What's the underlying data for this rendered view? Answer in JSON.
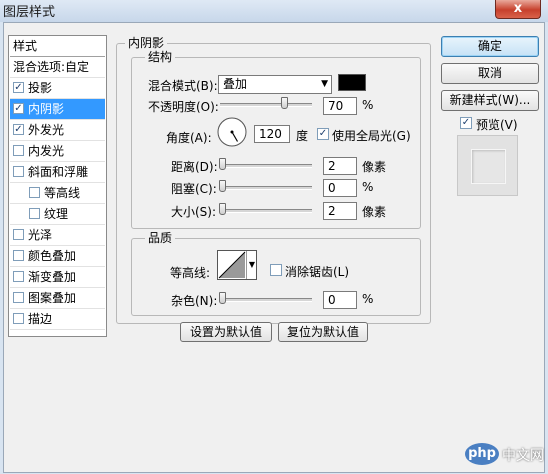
{
  "window": {
    "title": "图层样式",
    "close_glyph": "x"
  },
  "left_panel": {
    "header": "样式",
    "items": [
      {
        "label": "混合选项:自定",
        "checkbox": false,
        "checked": false,
        "selected": false,
        "indent": 0
      },
      {
        "label": "投影",
        "checkbox": true,
        "checked": true,
        "selected": false,
        "indent": 0
      },
      {
        "label": "内阴影",
        "checkbox": true,
        "checked": true,
        "selected": true,
        "indent": 0
      },
      {
        "label": "外发光",
        "checkbox": true,
        "checked": true,
        "selected": false,
        "indent": 0
      },
      {
        "label": "内发光",
        "checkbox": true,
        "checked": false,
        "selected": false,
        "indent": 0
      },
      {
        "label": "斜面和浮雕",
        "checkbox": true,
        "checked": false,
        "selected": false,
        "indent": 0
      },
      {
        "label": "等高线",
        "checkbox": true,
        "checked": false,
        "selected": false,
        "indent": 1
      },
      {
        "label": "纹理",
        "checkbox": true,
        "checked": false,
        "selected": false,
        "indent": 1
      },
      {
        "label": "光泽",
        "checkbox": true,
        "checked": false,
        "selected": false,
        "indent": 0
      },
      {
        "label": "颜色叠加",
        "checkbox": true,
        "checked": false,
        "selected": false,
        "indent": 0
      },
      {
        "label": "渐变叠加",
        "checkbox": true,
        "checked": false,
        "selected": false,
        "indent": 0
      },
      {
        "label": "图案叠加",
        "checkbox": true,
        "checked": false,
        "selected": false,
        "indent": 0
      },
      {
        "label": "描边",
        "checkbox": true,
        "checked": false,
        "selected": false,
        "indent": 0
      }
    ]
  },
  "inner_shadow": {
    "title": "内阴影",
    "structure": {
      "title": "结构",
      "blend_mode_label": "混合模式(B):",
      "blend_mode_value": "叠加",
      "color": "#000000",
      "opacity_label": "不透明度(O):",
      "opacity_value": "70",
      "opacity_fraction": 0.7,
      "percent": "%",
      "angle_label": "角度(A):",
      "angle_value": "120",
      "angle_deg": 120,
      "degree_unit": "度",
      "global_light_label": "使用全局光(G)",
      "global_light_checked": true,
      "distance_label": "距离(D):",
      "distance_value": "2",
      "pixel_unit": "像素",
      "choke_label": "阻塞(C):",
      "choke_value": "0",
      "size_label": "大小(S):",
      "size_value": "2"
    },
    "quality": {
      "title": "品质",
      "contour_label": "等高线:",
      "anti_alias_label": "消除锯齿(L)",
      "anti_alias_checked": false,
      "noise_label": "杂色(N):",
      "noise_value": "0"
    },
    "make_default_label": "设置为默认值",
    "reset_default_label": "复位为默认值"
  },
  "right_panel": {
    "ok_label": "确定",
    "cancel_label": "取消",
    "new_style_label": "新建样式(W)...",
    "preview_label": "预览(V)",
    "preview_checked": true
  },
  "watermark": {
    "text": "php",
    "suffix": "中文网"
  }
}
